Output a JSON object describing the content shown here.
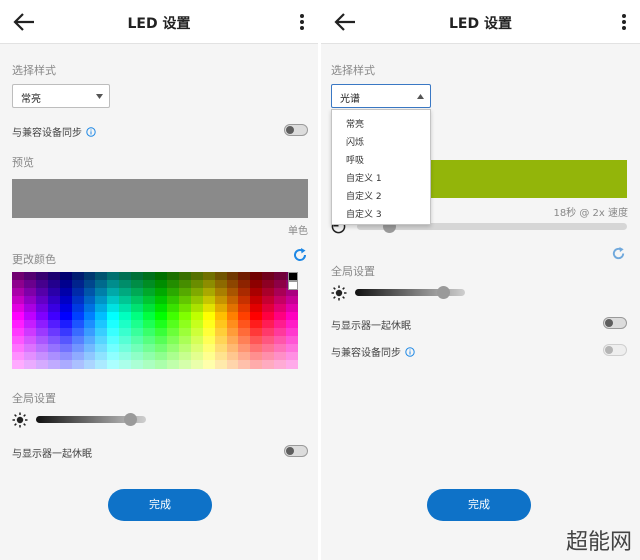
{
  "left": {
    "appbar": {
      "title": "LED 设置"
    },
    "style_section_label": "选择样式",
    "style_select_value": "常亮",
    "sync_label": "与兼容设备同步",
    "preview_label": "预览",
    "preview_color": "#8a8a8a",
    "preview_caption": "单色",
    "change_color_label": "更改颜色",
    "global_settings_label": "全局设置",
    "brightness_level": 0.85,
    "sleep_label": "与显示器一起休眠",
    "done_label": "完成"
  },
  "right": {
    "appbar": {
      "title": "LED 设置"
    },
    "style_section_label": "选择样式",
    "style_select_value": "光谱",
    "dropdown_options": [
      "常亮",
      "闪烁",
      "呼吸",
      "自定义 1",
      "自定义 2",
      "自定义 3"
    ],
    "preview_color": "#93b50a",
    "speed_caption": "18秒 @ 2x 速度",
    "speed_level": 0.12,
    "global_settings_label": "全局设置",
    "brightness_level": 0.8,
    "sleep_label": "与显示器一起休眠",
    "sync_label": "与兼容设备同步",
    "done_label": "完成"
  },
  "colors": {
    "accent": "#0e72c8",
    "info_icon": "#1e88e5"
  },
  "watermark": "超能网"
}
